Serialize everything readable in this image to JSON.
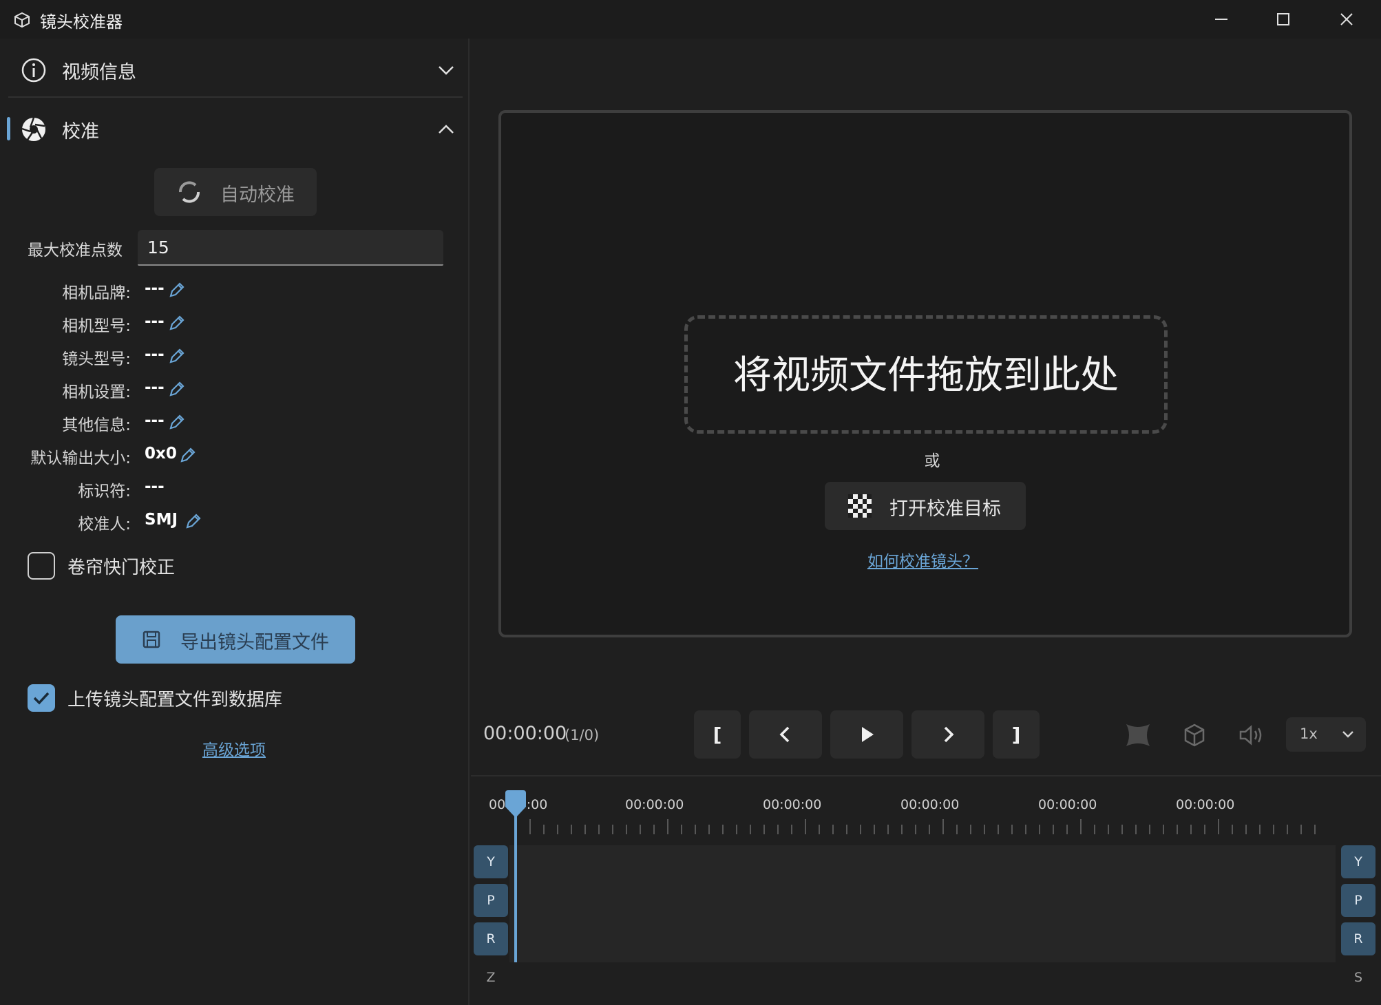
{
  "window": {
    "title": "镜头校准器",
    "minimize_label": "minimize",
    "maximize_label": "maximize",
    "close_label": "close"
  },
  "sidebar": {
    "video_info": {
      "label": "视频信息",
      "icon": "info-icon",
      "expanded": false
    },
    "calibration": {
      "label": "校准",
      "icon": "aperture-icon",
      "expanded": true
    },
    "auto_calibrate_label": "自动校准",
    "max_points": {
      "label": "最大校准点数",
      "value": "15"
    },
    "fields": [
      {
        "label": "相机品牌:",
        "value": "---",
        "editable": true
      },
      {
        "label": "相机型号:",
        "value": "---",
        "editable": true
      },
      {
        "label": "镜头型号:",
        "value": "---",
        "editable": true
      },
      {
        "label": "相机设置:",
        "value": "---",
        "editable": true
      },
      {
        "label": "其他信息:",
        "value": "---",
        "editable": true
      },
      {
        "label": "默认输出大小:",
        "value": "0x0",
        "editable": true
      },
      {
        "label": "标识符:",
        "value": "---",
        "editable": false
      },
      {
        "label": "校准人:",
        "value": "SMJ",
        "editable": true
      }
    ],
    "rolling_shutter": {
      "label": "卷帘快门校正",
      "checked": false
    },
    "export_label": "导出镜头配置文件",
    "upload": {
      "label": "上传镜头配置文件到数据库",
      "checked": true
    },
    "advanced_link": "高级选项"
  },
  "viewer": {
    "drop_text": "将视频文件拖放到此处",
    "or_text": "或",
    "open_target_label": "打开校准目标",
    "help_link": "如何校准镜头？"
  },
  "controls": {
    "timecode": "00:00:00",
    "frames": "(1/0)",
    "mark_in": "[",
    "mark_out": "]",
    "speed": "1x"
  },
  "timeline": {
    "tick_labels": [
      "00:00:00",
      "00:00:00",
      "00:00:00",
      "00:00:00",
      "00:00:00",
      "00:00:00"
    ],
    "left_axes": [
      "Y",
      "P",
      "R",
      "Z"
    ],
    "right_axes": [
      "Y",
      "P",
      "R",
      "S"
    ]
  },
  "colors": {
    "accent": "#6aa5d6",
    "background": "#1f1f1f",
    "button": "#2b2b2b",
    "axis_button": "#35536b"
  }
}
